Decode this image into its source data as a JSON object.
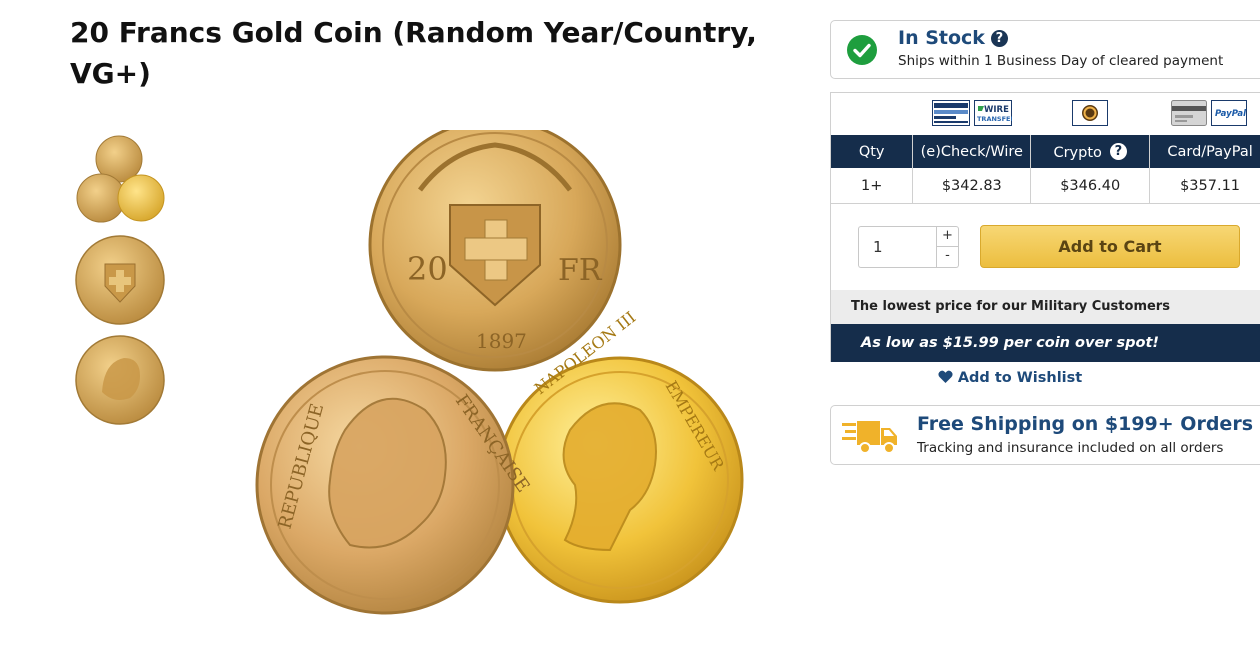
{
  "product": {
    "title": "20 Francs Gold Coin (Random Year/Country, VG+)",
    "thumbnails": [
      "three-coins-thumbnail",
      "swiss-coin-thumbnail",
      "vreneli-coin-thumbnail"
    ]
  },
  "main_image": {
    "coins": {
      "swiss": {
        "value": "20",
        "unit": "FR",
        "year": "1897"
      },
      "french_rooster": {
        "legend_left": "REPUBLIQUE",
        "legend_right": "FRANÇAISE"
      },
      "napoleon": {
        "legend_left": "NAPOLEON III",
        "legend_right": "EMPEREUR"
      }
    }
  },
  "stock": {
    "title": "In Stock",
    "subtitle": "Ships within 1 Business Day of cleared payment"
  },
  "payment_icons": [
    "echeck-icon",
    "wire-transfer-icon",
    "crypto-icon",
    "credit-card-icon",
    "paypal-icon"
  ],
  "payment_icon_labels": {
    "wire": "WIRE",
    "wire_sub": "TRANSFER",
    "paypal": "PayPal"
  },
  "price_table": {
    "headers": [
      "Qty",
      "(e)Check/Wire",
      "Crypto",
      "Card/PayPal"
    ],
    "rows": [
      [
        "1+",
        "$342.83",
        "$346.40",
        "$357.11"
      ]
    ]
  },
  "cart": {
    "quantity": "1",
    "plus": "+",
    "minus": "-",
    "add_label": "Add to Cart"
  },
  "military": {
    "text": "The lowest price for our Military Customers"
  },
  "promo": {
    "text": "As low as $15.99 per coin over spot!"
  },
  "wishlist": {
    "label": "Add to Wishlist"
  },
  "shipping": {
    "title": "Free Shipping on $199+ Orders",
    "subtitle": "Tracking and insurance included on all orders"
  },
  "colors": {
    "navy": "#152d4b",
    "link_blue": "#1e4a7a",
    "gold_button": "#ecbe3f",
    "success_green": "#1e9e3e"
  }
}
